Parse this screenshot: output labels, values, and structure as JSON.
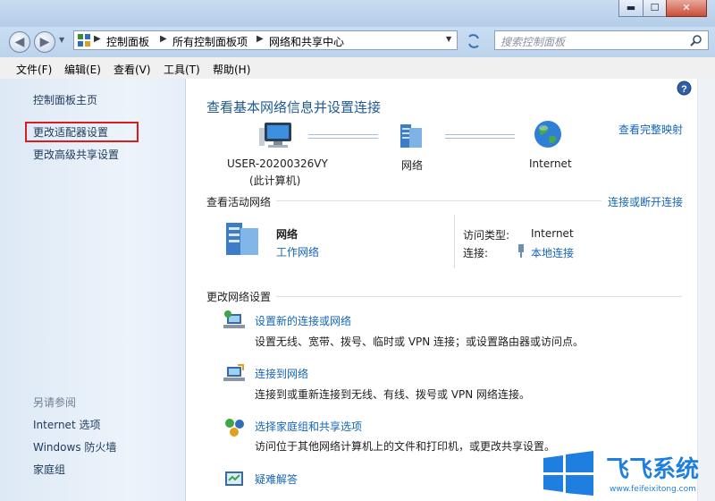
{
  "window": {
    "min": "▬",
    "max": "☐",
    "close": "✕"
  },
  "nav": {
    "crumbs": [
      "控制面板",
      "所有控制面板项",
      "网络和共享中心"
    ],
    "search_placeholder": "搜索控制面板"
  },
  "menubar": [
    "文件(F)",
    "编辑(E)",
    "查看(V)",
    "工具(T)",
    "帮助(H)"
  ],
  "left": {
    "home": "控制面板主页",
    "adapter": "更改适配器设置",
    "advanced": "更改高级共享设置",
    "see_also": "另请参阅",
    "internet_options": "Internet 选项",
    "firewall": "Windows 防火墙",
    "homegroup": "家庭组"
  },
  "main": {
    "title": "查看基本网络信息并设置连接",
    "full_map": "查看完整映射",
    "computer_name": "USER-20200326VY",
    "computer_sub": "(此计算机)",
    "network": "网络",
    "internet": "Internet",
    "active_title": "查看活动网络",
    "connect_disconnect": "连接或断开连接",
    "net_name": "网络",
    "net_type": "工作网络",
    "access_label": "访问类型:",
    "access_value": "Internet",
    "conn_label": "连接:",
    "conn_value": "本地连接",
    "change_title": "更改网络设置",
    "tasks": [
      {
        "title": "设置新的连接或网络",
        "desc": "设置无线、宽带、拨号、临时或 VPN 连接；或设置路由器或访问点。"
      },
      {
        "title": "连接到网络",
        "desc": "连接到或重新连接到无线、有线、拨号或 VPN 网络连接。"
      },
      {
        "title": "选择家庭组和共享选项",
        "desc": "访问位于其他网络计算机上的文件和打印机，或更改共享设置。"
      },
      {
        "title": "疑难解答",
        "desc": ""
      }
    ]
  },
  "watermark": {
    "text": "飞飞系统",
    "url": "www.feifeixitong.com"
  },
  "colors": {
    "link": "#1565b8",
    "title": "#1f5a96",
    "highlight": "#d81e1e"
  }
}
